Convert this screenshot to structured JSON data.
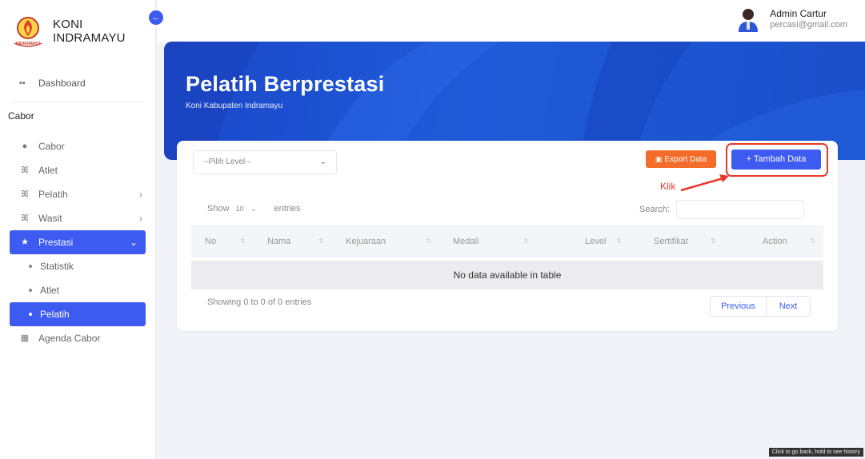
{
  "app": {
    "brand_line1": "KONI",
    "brand_line2": "INDRAMAYU",
    "logo_text": "INDRAMAYU"
  },
  "sidebar": {
    "dashboard": "Dashboard",
    "section": "Cabor",
    "items": [
      {
        "label": "Cabor",
        "icon": "trophy-icon"
      },
      {
        "label": "Atlet",
        "icon": "users-icon"
      },
      {
        "label": "Pelatih",
        "icon": "users-icon",
        "chevron": "›"
      },
      {
        "label": "Wasit",
        "icon": "users-icon",
        "chevron": "›"
      },
      {
        "label": "Prestasi",
        "icon": "star-icon",
        "chevron": "⌄"
      }
    ],
    "sub_items": [
      "Statistik",
      "Atlet",
      "Pelatih"
    ],
    "agenda": "Agenda Cabor"
  },
  "user": {
    "name": "Admin Cartur",
    "email": "percasi@gmail.com"
  },
  "hero": {
    "title": "Pelatih Berprestasi",
    "subtitle": "Koni Kabupaten Indramayu"
  },
  "toolbar": {
    "level_placeholder": "--Pilih Level--",
    "export_label": "Export Data",
    "add_label": "+ Tambah Data",
    "annotation": "Klik"
  },
  "table": {
    "show_label": "Show",
    "entries_value": "10",
    "entries_label": "entries",
    "search_label": "Search:",
    "columns": [
      "No",
      "Nama",
      "Kejuaraan",
      "Medali",
      "Level",
      "Sertifikat",
      "Action"
    ],
    "empty_message": "No data available in table",
    "info": "Showing 0 to 0 of 0 entries",
    "prev": "Previous",
    "next": "Next"
  },
  "browser_tip": "Click to go back, hold to see history",
  "colors": {
    "accent": "#3d5af1",
    "export": "#f36c2a",
    "annotation": "#e8382a"
  }
}
